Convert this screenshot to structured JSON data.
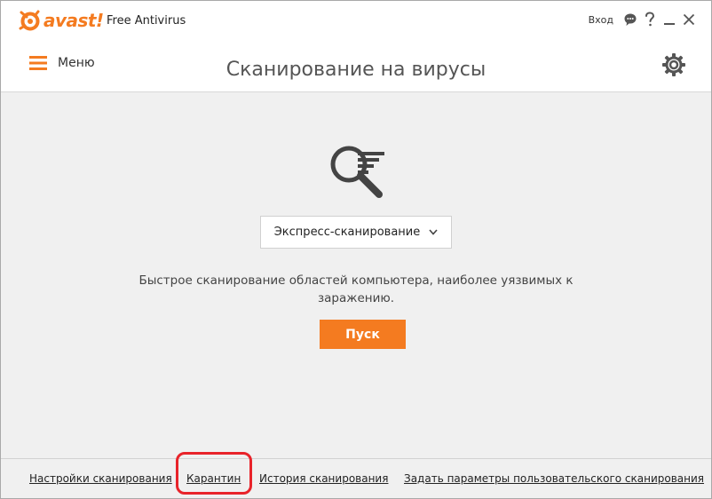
{
  "app": {
    "logo_text": "avast!",
    "product_name": "Free Antivirus"
  },
  "window_controls": {
    "login_label": "Вход",
    "icons": [
      "chat-icon",
      "help-icon",
      "minimize-icon",
      "close-icon"
    ]
  },
  "header": {
    "menu_label": "Меню",
    "title": "Сканирование на вирусы"
  },
  "scan": {
    "selected_type": "Экспресс-сканирование",
    "description": "Быстрое сканирование областей компьютера, наиболее уязвимых к заражению.",
    "start_label": "Пуск"
  },
  "footer": {
    "links": [
      "Настройки сканирования",
      "Карантин",
      "История сканирования",
      "Задать параметры пользовательского сканирования"
    ]
  },
  "colors": {
    "accent": "#f47b20",
    "highlight": "#e8232a"
  }
}
